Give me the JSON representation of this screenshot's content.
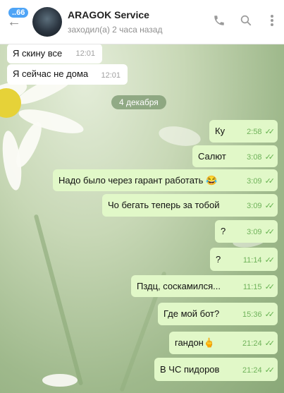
{
  "header": {
    "unread_badge": "..66",
    "contact_name": "ARAGOK Service",
    "status": "заходил(а) 2 часа назад"
  },
  "date_divider": "4 декабря",
  "incoming": [
    {
      "text": "Я скину все",
      "time": "12:01"
    },
    {
      "text": "Я сейчас не дома",
      "time": "12:01"
    }
  ],
  "outgoing": [
    {
      "text": "Ку",
      "time": "2:58"
    },
    {
      "text": "Салют",
      "time": "3:08"
    },
    {
      "text": "Надо было через гарант работать 😂",
      "time": "3:09"
    },
    {
      "text": "Чо бегать теперь за тобой",
      "time": "3:09"
    },
    {
      "text": "?",
      "time": "3:09"
    },
    {
      "text": "?",
      "time": "11:14"
    },
    {
      "text": "Пздц, соскамился...",
      "time": "11:15"
    },
    {
      "text": "Где мой бот?",
      "time": "15:36"
    },
    {
      "text": "гандон🖕",
      "time": "21:24"
    },
    {
      "text": "В ЧС пидоров",
      "time": "21:24"
    }
  ]
}
